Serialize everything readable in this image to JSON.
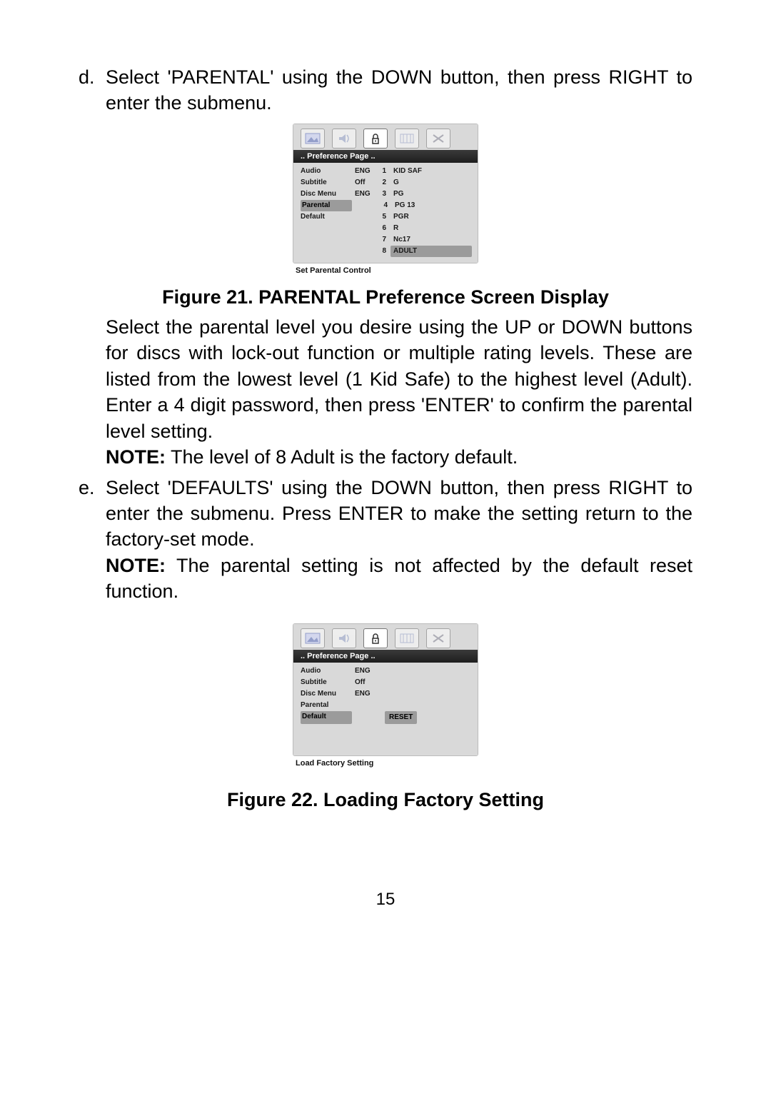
{
  "steps": {
    "d": {
      "marker": "d.",
      "intro": "Select 'PARENTAL' using the DOWN button, then press RIGHT to enter the submenu.",
      "desc": "Select the parental level you desire using the UP or DOWN buttons for discs with lock-out function or multiple rating levels. These are listed from the lowest level (1 Kid Safe) to the highest level (Adult). Enter a 4 digit password, then press 'ENTER' to confirm the parental level setting.",
      "note_label": "NOTE:",
      "note": " The level of 8 Adult is the factory default."
    },
    "e": {
      "marker": "e.",
      "intro": "Select 'DEFAULTS' using the DOWN button, then press RIGHT to enter the submenu. Press ENTER to make the setting return to the factory-set mode.",
      "note_label": "NOTE:",
      "note": " The parental setting is not affected by the default reset function."
    }
  },
  "captions": {
    "fig21": "Figure 21. PARENTAL Preference Screen Display",
    "fig22": "Figure 22. Loading Factory Setting"
  },
  "osd": {
    "bar": "..  Preference  Page  ..",
    "footer1": "Set  Parental  Control",
    "footer2": "Load  Factory  Setting",
    "left": {
      "audio": "Audio",
      "subtitle": "Subtitle",
      "disc_menu": "Disc  Menu",
      "parental": "Parental",
      "default": "Default"
    },
    "vals": {
      "eng": "ENG",
      "off": "Off"
    },
    "ratings": [
      {
        "n": "1",
        "label": "KID  SAF"
      },
      {
        "n": "2",
        "label": "G"
      },
      {
        "n": "3",
        "label": "PG"
      },
      {
        "n": "4",
        "label": "PG  13"
      },
      {
        "n": "5",
        "label": "PGR"
      },
      {
        "n": "6",
        "label": "R"
      },
      {
        "n": "7",
        "label": "Nc17"
      },
      {
        "n": "8",
        "label": "ADULT"
      }
    ],
    "reset": "RESET"
  },
  "page_number": "15"
}
